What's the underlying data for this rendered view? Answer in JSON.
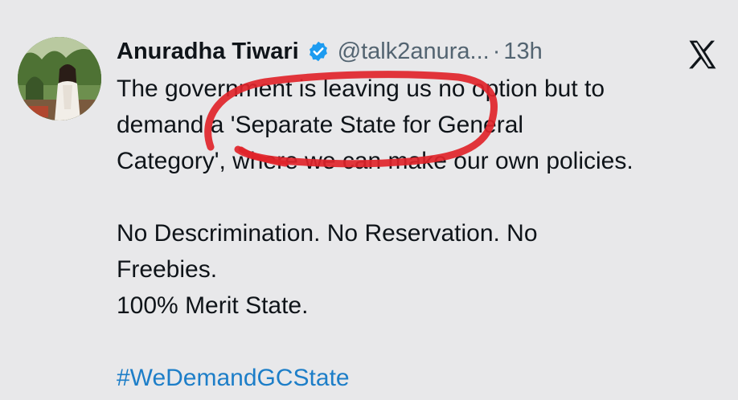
{
  "tweet": {
    "author_name": "Anuradha Tiwari",
    "handle": "@talk2anura...",
    "separator": "·",
    "timestamp": "13h",
    "lines": [
      "The government is leaving us no option but to",
      "demand a 'Separate State for General",
      "Category', where we can make our own policies."
    ],
    "lines2": [
      "No Descrimination. No Reservation. No",
      "Freebies.",
      "100% Merit State."
    ],
    "hashtag": "#WeDemandGCState"
  },
  "icons": {
    "verified": "verified-badge-icon",
    "platform": "x-logo-icon"
  },
  "colors": {
    "background": "#e8e8ea",
    "text": "#0f1419",
    "muted": "#536471",
    "link": "#1d7ec8",
    "verified": "#1d9bf0",
    "annotation": "#e0242a"
  }
}
